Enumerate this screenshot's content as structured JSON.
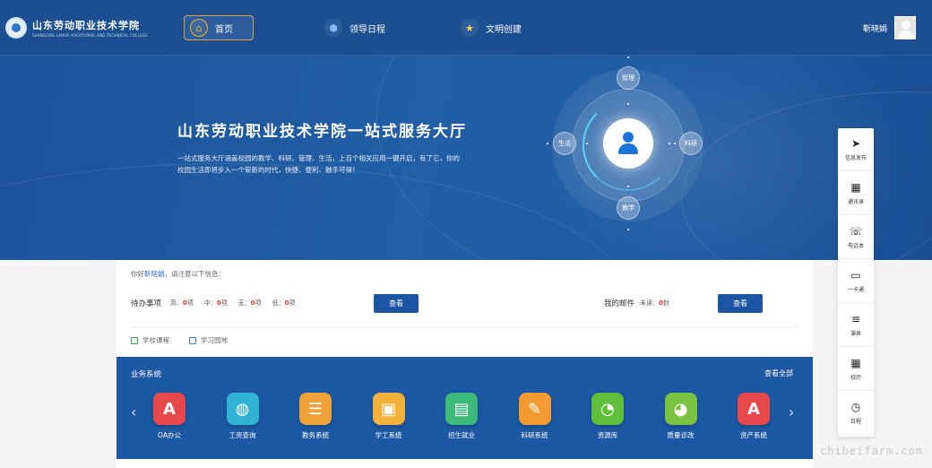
{
  "header": {
    "logo_text": "山东劳动职业技术学院",
    "logo_subtext": "SHANDONG LABOR VOCATIONAL AND TECHNICAL COLLEGE",
    "nav": [
      {
        "label": "首页",
        "icon": "home-icon"
      },
      {
        "label": "领导日程",
        "icon": "schedule-icon"
      },
      {
        "label": "文明创建",
        "icon": "civilization-icon"
      }
    ],
    "user_name": "靳晓娟"
  },
  "banner": {
    "title": "山东劳动职业技术学院一站式服务大厅",
    "description": "一站式服务大厅涵盖校园的教学、科研、管理、生活，上百个相关应用一键开启，有了它，你的校园生活即将步入一个崭新的时代，快捷、便利、触手可得！",
    "orbit_nodes": {
      "top": "管理",
      "left": "生活",
      "right": "科研",
      "bottom": "教学"
    }
  },
  "dock": [
    {
      "label": "信息发布",
      "icon": "send-icon"
    },
    {
      "label": "通讯录",
      "icon": "address-book-icon"
    },
    {
      "label": "电话本",
      "icon": "phone-icon"
    },
    {
      "label": "一卡通",
      "icon": "card-icon"
    },
    {
      "label": "课表",
      "icon": "timetable-icon"
    },
    {
      "label": "校历",
      "icon": "calendar-icon"
    },
    {
      "label": "日程",
      "icon": "clock-icon"
    }
  ],
  "info": {
    "greeting_prefix": "你好",
    "greeting_name": "靳晓娟",
    "greeting_suffix": "，请注意以下信息：",
    "todo_label": "待办事项",
    "todo": [
      {
        "label": "高：",
        "count": "0",
        "unit": "项"
      },
      {
        "label": "中：",
        "count": "0",
        "unit": "项"
      },
      {
        "label": "无：",
        "count": "0",
        "unit": "项"
      },
      {
        "label": "低：",
        "count": "0",
        "unit": "项"
      }
    ],
    "todo_button": "查看",
    "mail_label": "我的邮件",
    "mail_unread_label": "未读：",
    "mail_unread_count": "0",
    "mail_unit": "封",
    "mail_button": "查看",
    "links": [
      "学校课程",
      "学习园地"
    ]
  },
  "business": {
    "title": "业务系统",
    "view_all": "查看全部",
    "apps": [
      {
        "name": "OA办公",
        "color": "#e8474b",
        "glyph": "A"
      },
      {
        "name": "工资查询",
        "color": "#2fb3d6",
        "glyph": "◍"
      },
      {
        "name": "教务系统",
        "color": "#f0a23a",
        "glyph": "☰"
      },
      {
        "name": "学工系统",
        "color": "#f4b23c",
        "glyph": "▣"
      },
      {
        "name": "招生就业",
        "color": "#3dba7a",
        "glyph": "▤"
      },
      {
        "name": "科研系统",
        "color": "#f39b33",
        "glyph": "✎"
      },
      {
        "name": "资源库",
        "color": "#5fbf3a",
        "glyph": "◔"
      },
      {
        "name": "质量诊改",
        "color": "#79c441",
        "glyph": "◕"
      },
      {
        "name": "资产系统",
        "color": "#e8474b",
        "glyph": "A"
      }
    ]
  },
  "watermark": "chibeifarm.com"
}
